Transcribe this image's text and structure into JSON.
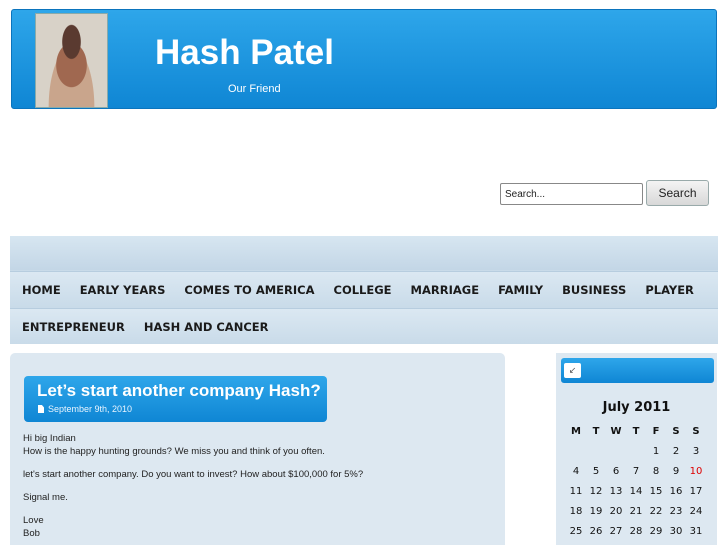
{
  "header": {
    "title": "Hash Patel",
    "tagline": "Our Friend"
  },
  "search": {
    "value": "Search...",
    "button_label": "Search"
  },
  "nav": {
    "row1": [
      "HOME",
      "EARLY YEARS",
      "COMES TO AMERICA",
      "COLLEGE",
      "MARRIAGE",
      "FAMILY",
      "BUSINESS",
      "PLAYER"
    ],
    "row2": [
      "ENTREPRENEUR",
      "HASH AND CANCER"
    ]
  },
  "post": {
    "title": "Let’s start another company Hash?",
    "date": "September 9th, 2010",
    "body": [
      "Hi big Indian",
      "How is the happy hunting grounds? We miss you and think of you often.",
      "let's start another company. Do you want to invest? How about $100,000 for 5%?",
      "Signal me.",
      "Love",
      "Bob"
    ]
  },
  "calendar": {
    "title": "July 2011",
    "weekdays": [
      "M",
      "T",
      "W",
      "T",
      "F",
      "S",
      "S"
    ],
    "weeks": [
      [
        "",
        "",
        "",
        "",
        "1",
        "2",
        "3"
      ],
      [
        "4",
        "5",
        "6",
        "7",
        "8",
        "9",
        "10"
      ],
      [
        "11",
        "12",
        "13",
        "14",
        "15",
        "16",
        "17"
      ],
      [
        "18",
        "19",
        "20",
        "21",
        "22",
        "23",
        "24"
      ],
      [
        "25",
        "26",
        "27",
        "28",
        "29",
        "30",
        "31"
      ]
    ],
    "highlight_day": "10",
    "highlight_color": "#dd0000"
  },
  "colors": {
    "accent_blue": "#1a96de",
    "panel_bg": "#dde8f1"
  }
}
